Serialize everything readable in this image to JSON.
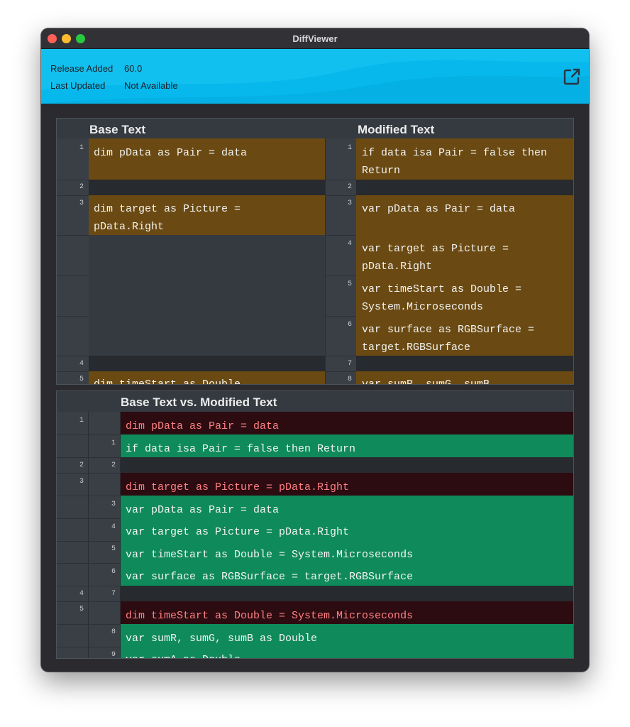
{
  "window": {
    "title": "DiffViewer"
  },
  "header": {
    "release_added_label": "Release Added",
    "release_added_value": "60.0",
    "last_updated_label": "Last Updated",
    "last_updated_value": "Not Available",
    "icon": "external-link-icon"
  },
  "side_by_side": {
    "left_title": "Base Text",
    "right_title": "Modified Text",
    "left_nums": [
      "1",
      "2",
      "3",
      "4",
      "5"
    ],
    "right_nums": [
      "1",
      "2",
      "3",
      "4",
      "5",
      "6",
      "7",
      "8"
    ],
    "left_lines": [
      "dim pData as Pair = data",
      "dim target as Picture = pData.Right",
      "dim timeStart as Double"
    ],
    "right_lines": [
      "if data isa Pair = false then Return",
      "var pData as Pair = data",
      "var target as Picture = pData.Right",
      "var timeStart as Double = System.Microseconds",
      "var surface as RGBSurface = target.RGBSurface",
      "var sumR, sumG, sumB"
    ]
  },
  "inline": {
    "title": "Base Text vs. Modified Text",
    "base_nums": [
      "1",
      "2",
      "3",
      "4",
      "5"
    ],
    "mod_nums": [
      "1",
      "2",
      "3",
      "4",
      "5",
      "6",
      "7",
      "8",
      "9"
    ],
    "lines": [
      "dim pData as Pair = data",
      "if data isa Pair = false then Return",
      "dim target as Picture = pData.Right",
      "var pData as Pair = data",
      "var target as Picture = pData.Right",
      "var timeStart as Double = System.Microseconds",
      "var surface as RGBSurface = target.RGBSurface",
      "dim timeStart as Double = System.Microseconds",
      "var sumR, sumG, sumB as Double",
      "var sumA as Double"
    ]
  },
  "colors": {
    "header_bg": "#06b8ec",
    "modified_bg": "#6a4a12",
    "deleted_bg": "#2c0c11",
    "deleted_text": "#ff7f83",
    "inserted_bg": "#0f8a5b"
  }
}
